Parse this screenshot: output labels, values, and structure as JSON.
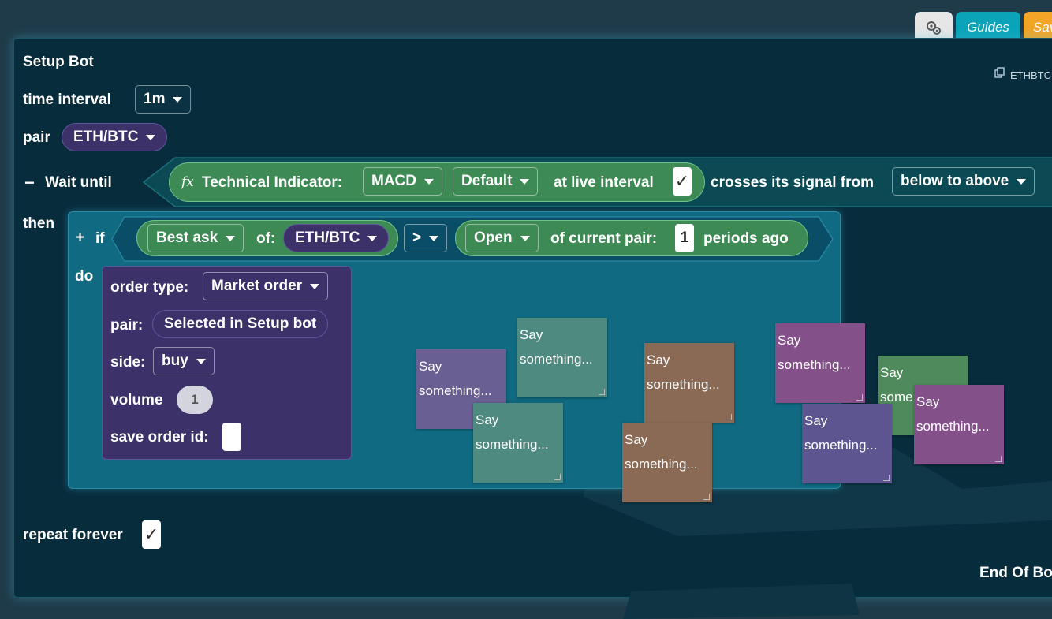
{
  "toolbar": {
    "guides_label": "Guides",
    "save_label": "Sav",
    "settings_icon": "gears-icon"
  },
  "workspace": {
    "pair_tag": "ETHBTC",
    "end_label": "End Of Bo"
  },
  "setup": {
    "title": "Setup Bot",
    "time_interval_label": "time interval",
    "time_interval_value": "1m",
    "pair_label": "pair",
    "pair_value": "ETH/BTC"
  },
  "wait": {
    "collapse_symbol": "−",
    "label": "Wait until",
    "fx_symbol": "fx",
    "indicator_label": "Technical Indicator:",
    "indicator_value": "MACD",
    "preset_value": "Default",
    "live_interval_label": "at live interval",
    "live_interval_checked": "✓",
    "crosses_label": "crosses its signal from",
    "direction_value": "below to above"
  },
  "then_label": "then",
  "if_block": {
    "plus_symbol": "+",
    "label": "if",
    "price_value": "Best ask",
    "of_label": "of:",
    "pair_value": "ETH/BTC",
    "operator_value": ">",
    "candle_value": "Open",
    "current_pair_label": "of current pair:",
    "periods_value": "1",
    "periods_label": "periods ago"
  },
  "do_label": "do",
  "order": {
    "type_label": "order type:",
    "type_value": "Market order",
    "pair_label": "pair:",
    "pair_value": "Selected in Setup bot",
    "side_label": "side:",
    "side_value": "buy",
    "volume_label": "volume",
    "volume_value": "1",
    "save_id_label": "save order id:"
  },
  "comments": [
    {
      "line1": "Say",
      "line2": "something...",
      "color": "#6a5f92"
    },
    {
      "line1": "Say",
      "line2": "something...",
      "color": "#4f8a80"
    },
    {
      "line1": "Say",
      "line2": "something...",
      "color": "#4f8a80"
    },
    {
      "line1": "Say",
      "line2": "something...",
      "color": "#8a6a55"
    },
    {
      "line1": "Say",
      "line2": "something...",
      "color": "#8a6a55"
    },
    {
      "line1": "Say",
      "line2": "something...",
      "color": "#84508a"
    },
    {
      "line1": "Say",
      "line2": "some",
      "color": "#4e8a5b"
    },
    {
      "line1": "Say",
      "line2": "something...",
      "color": "#5c5590"
    },
    {
      "line1": "Say",
      "line2": "something...",
      "color": "#84508a"
    }
  ],
  "repeat": {
    "label": "repeat forever",
    "checked": "✓"
  },
  "colors": {
    "workspace_bg": "#072c3c",
    "teal_block": "#0f6a82",
    "green_block": "#3e8a55",
    "purple_block": "#3c3169",
    "guides_button": "#0aa3b8",
    "save_button": "#f3a527"
  }
}
